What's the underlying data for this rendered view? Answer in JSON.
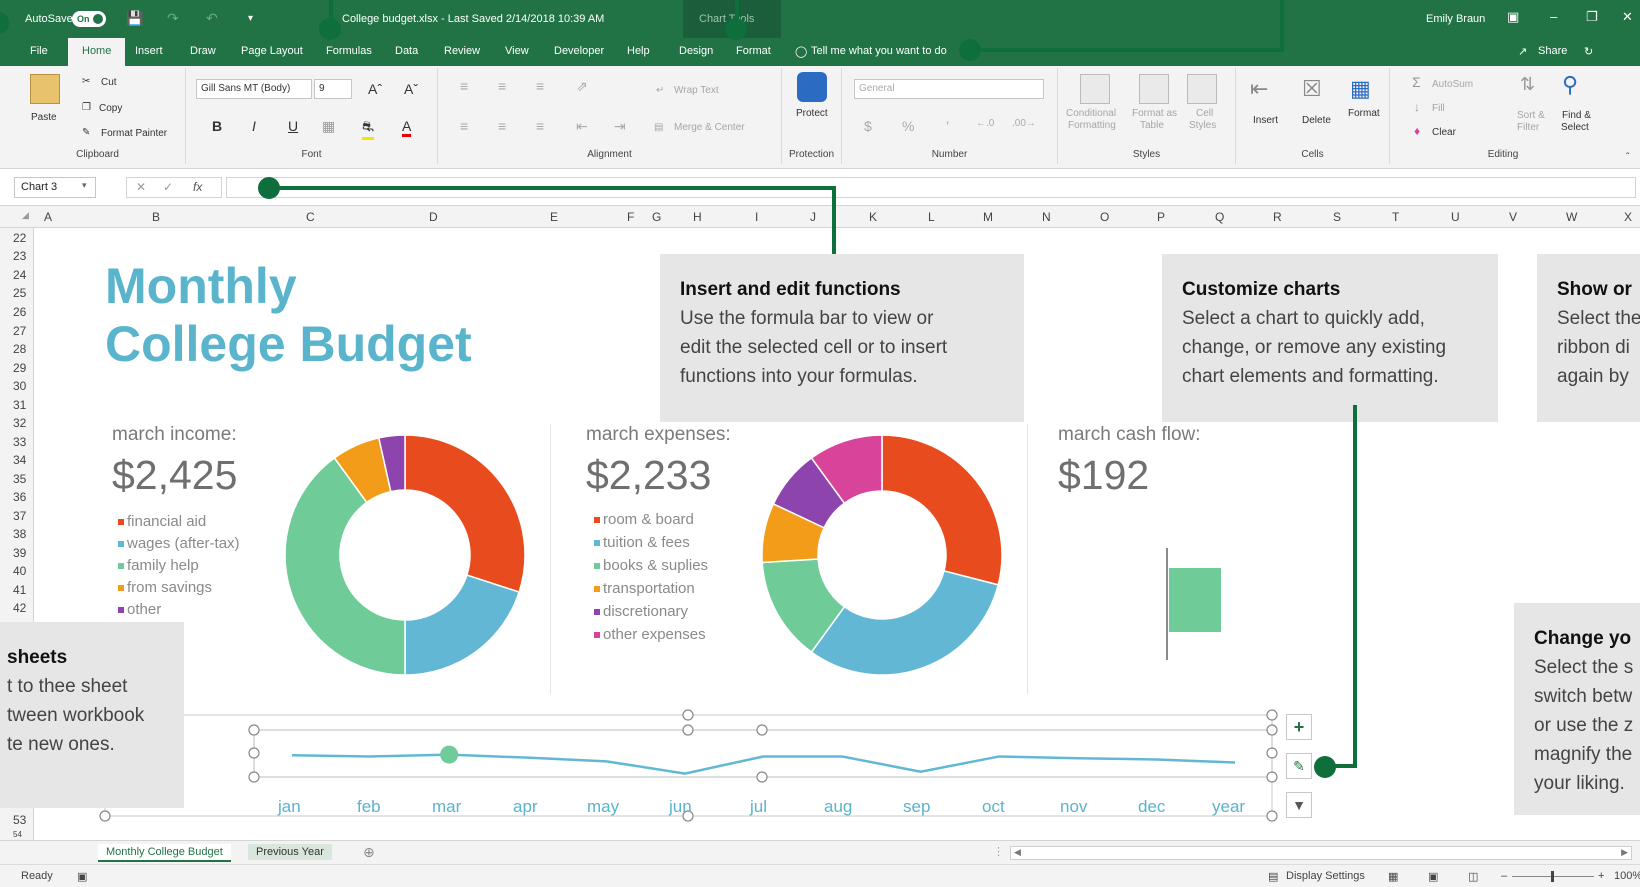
{
  "titlebar": {
    "autosave_label": "AutoSave",
    "autosave_state": "On",
    "document_title": "College budget.xlsx - Last Saved 2/14/2018 10:39 AM",
    "context_group": "Chart Tools",
    "user_name": "Emily Braun",
    "share_label": "Share"
  },
  "tabs": [
    "File",
    "Home",
    "Insert",
    "Draw",
    "Page Layout",
    "Formulas",
    "Data",
    "Review",
    "View",
    "Developer",
    "Help",
    "Design",
    "Format"
  ],
  "tell_me": "Tell me what you want to do",
  "ribbon": {
    "clipboard": {
      "paste": "Paste",
      "cut": "Cut",
      "copy": "Copy",
      "format_painter": "Format Painter",
      "label": "Clipboard"
    },
    "font": {
      "name": "Gill Sans MT (Body)",
      "size": "9",
      "label": "Font"
    },
    "alignment": {
      "wrap_text": "Wrap Text",
      "merge_center": "Merge & Center",
      "label": "Alignment"
    },
    "protection": {
      "protect": "Protect",
      "label": "Protection"
    },
    "number": {
      "format": "General",
      "label": "Number"
    },
    "styles": {
      "conditional": "Conditional",
      "conditional2": "Formatting",
      "format_as": "Format as",
      "format_as2": "Table",
      "cell": "Cell",
      "cell2": "Styles",
      "label": "Styles"
    },
    "cells": {
      "insert": "Insert",
      "delete": "Delete",
      "format": "Format",
      "label": "Cells"
    },
    "editing": {
      "autosum": "AutoSum",
      "fill": "Fill",
      "clear": "Clear",
      "sort": "Sort &",
      "sort2": "Filter",
      "find": "Find &",
      "find2": "Select",
      "label": "Editing"
    }
  },
  "formula_bar": {
    "name_box": "Chart 3"
  },
  "columns": [
    "A",
    "B",
    "C",
    "D",
    "E",
    "F",
    "G",
    "H",
    "I",
    "J",
    "K",
    "L",
    "M",
    "N",
    "O",
    "P",
    "Q",
    "R",
    "S",
    "T",
    "U",
    "V",
    "W",
    "X"
  ],
  "rows": [
    "22",
    "23",
    "24",
    "25",
    "26",
    "27",
    "28",
    "29",
    "30",
    "31",
    "32",
    "33",
    "34",
    "35",
    "36",
    "37",
    "38",
    "39",
    "40",
    "41",
    "42",
    "53",
    "54"
  ],
  "dashboard": {
    "title_line1": "Monthly",
    "title_line2": "College Budget",
    "income": {
      "label": "march income:",
      "amount": "$2,425",
      "legend": [
        "financial aid",
        "wages (after-tax)",
        "family help",
        "from savings",
        "other"
      ]
    },
    "expenses": {
      "label": "march expenses:",
      "amount": "$2,233",
      "legend": [
        "room & board",
        "tuition & fees",
        "books & suplies",
        "transportation",
        "discretionary",
        "other expenses"
      ]
    },
    "cashflow": {
      "label": "march cash flow:",
      "amount": "$192"
    }
  },
  "colors": {
    "accent": "#217346",
    "orange_red": "#e84c1e",
    "blue": "#62b8d4",
    "green": "#6fcc98",
    "orange": "#f39c19",
    "purple": "#8e44ad",
    "pink": "#d9449b"
  },
  "chart_data": [
    {
      "type": "pie",
      "categories": [
        "financial aid",
        "wages (after-tax)",
        "family help",
        "from savings",
        "other"
      ],
      "values": [
        30,
        20,
        40,
        6.5,
        3.5
      ]
    },
    {
      "type": "pie",
      "categories": [
        "room & board",
        "tuition & fees",
        "books & suplies",
        "transportation",
        "discretionary",
        "other expenses"
      ],
      "values": [
        29,
        31,
        14,
        8,
        8,
        10
      ]
    },
    {
      "type": "bar",
      "categories": [
        "march"
      ],
      "values": [
        192
      ]
    },
    {
      "type": "line",
      "x": [
        "jan",
        "feb",
        "mar",
        "apr",
        "may",
        "jun",
        "jul",
        "aug",
        "sep",
        "oct",
        "nov",
        "dec",
        "year"
      ],
      "values": [
        52,
        50,
        53,
        48,
        42,
        22,
        50,
        50,
        25,
        50,
        47,
        45,
        40
      ],
      "ylim": [
        0,
        100
      ]
    }
  ],
  "callouts": {
    "functions": {
      "title": "Insert and edit functions",
      "lines": [
        "Use the formula bar to view or",
        "edit the selected cell or to insert",
        "functions into your formulas."
      ]
    },
    "charts": {
      "title": "Customize charts",
      "lines": [
        "Select a chart to quickly add,",
        "change, or remove any existing",
        "chart elements and formatting."
      ]
    },
    "ribbon": {
      "title": "Show or",
      "lines": [
        "Select the",
        "ribbon di",
        "again by"
      ]
    },
    "sheets": {
      "title": "sheets",
      "lines": [
        "t to thee sheet",
        "tween workbook",
        "te new ones."
      ]
    },
    "zoom": {
      "title": "Change yo",
      "lines": [
        "Select the s",
        "switch betw",
        "or use the z",
        "magnify the",
        "your liking."
      ]
    }
  },
  "sheet_tabs": [
    "Monthly College Budget",
    "Previous Year"
  ],
  "status": {
    "ready": "Ready",
    "display_settings": "Display Settings",
    "zoom": "100%"
  }
}
